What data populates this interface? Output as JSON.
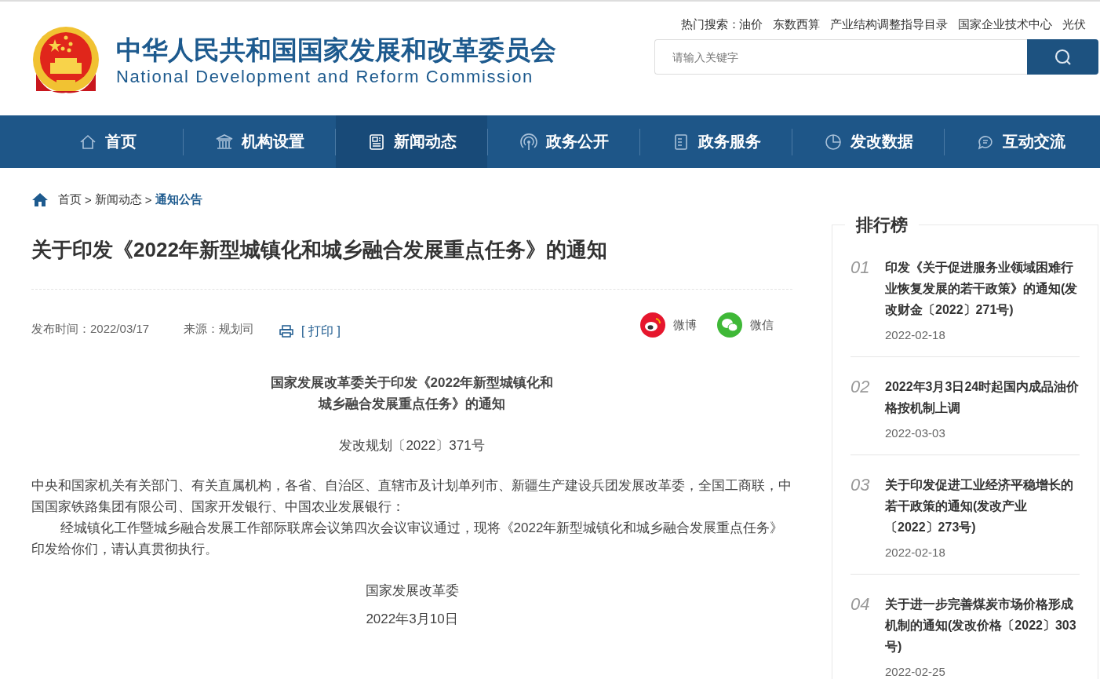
{
  "header": {
    "title": "中华人民共和国国家发展和改革委员会",
    "subtitle": "National Development and Reform Commission",
    "hot_search": {
      "label": "热门搜索：",
      "terms": [
        "油价",
        "东数西算",
        "产业结构调整指导目录",
        "国家企业技术中心",
        "光伏"
      ]
    },
    "search": {
      "placeholder": "请输入关键字"
    }
  },
  "nav": [
    {
      "label": "首页",
      "selected": false
    },
    {
      "label": "机构设置",
      "selected": false
    },
    {
      "label": "新闻动态",
      "selected": true
    },
    {
      "label": "政务公开",
      "selected": false
    },
    {
      "label": "政务服务",
      "selected": false
    },
    {
      "label": "发改数据",
      "selected": false
    },
    {
      "label": "互动交流",
      "selected": false
    }
  ],
  "breadcrumb": [
    {
      "label": "首页",
      "current": false
    },
    {
      "separator": ">",
      "label": "新闻动态",
      "current": false
    },
    {
      "separator": ">",
      "label": "通知公告",
      "current": true
    }
  ],
  "article": {
    "title": "关于印发《2022年新型城镇化和城乡融合发展重点任务》的通知",
    "meta": {
      "published": "发布时间：2022/03/17",
      "source": "来源：规划司",
      "print": "[ 打印 ]"
    },
    "share": [
      {
        "label": "微博",
        "kind": "weibo"
      },
      {
        "label": "微信",
        "kind": "wechat"
      }
    ],
    "heading": [
      "国家发展改革委关于印发《2022年新型城镇化和",
      "城乡融合发展重点任务》的通知"
    ],
    "doc_number": "发改规划〔2022〕371号",
    "paragraphs": [
      {
        "text": "中央和国家机关有关部门、有关直属机构，各省、自治区、直辖市及计划单列市、新疆生产建设兵团发展改革委，全国工商联，中国国家铁路集团有限公司、国家开发银行、中国农业发展银行：",
        "indent": false
      },
      {
        "text": "经城镇化工作暨城乡融合发展工作部际联席会议第四次会议审议通过，现将《2022年新型城镇化和城乡融合发展重点任务》印发给你们，请认真贯彻执行。",
        "indent": true
      }
    ],
    "signature": "国家发展改革委",
    "date": "2022年3月10日"
  },
  "ranking": {
    "title": "排行榜",
    "items": [
      {
        "rank": "01",
        "title": "印发《关于促进服务业领域困难行业恢复发展的若干政策》的通知(发改财金〔2022〕271号)",
        "date": "2022-02-18"
      },
      {
        "rank": "02",
        "title": "2022年3月3日24时起国内成品油价格按机制上调",
        "date": "2022-03-03"
      },
      {
        "rank": "03",
        "title": "关于印发促进工业经济平稳增长的若干政策的通知(发改产业〔2022〕273号)",
        "date": "2022-02-18"
      },
      {
        "rank": "04",
        "title": "关于进一步完善煤炭市场价格形成机制的通知(发改价格〔2022〕303号)",
        "date": "2022-02-25"
      }
    ]
  }
}
